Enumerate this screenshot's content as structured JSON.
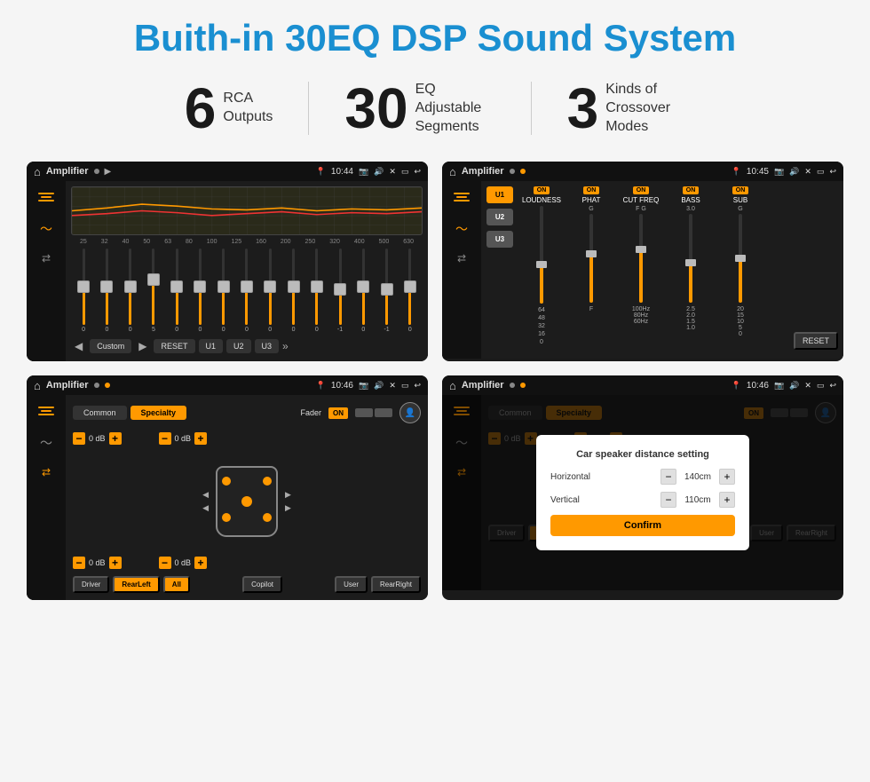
{
  "header": {
    "title": "Buith-in 30EQ DSP Sound System"
  },
  "stats": [
    {
      "number": "6",
      "text": "RCA\nOutputs"
    },
    {
      "number": "30",
      "text": "EQ Adjustable\nSegments"
    },
    {
      "number": "3",
      "text": "Kinds of\nCrossover Modes"
    }
  ],
  "screens": {
    "eq": {
      "topbar": {
        "title": "Amplifier",
        "time": "10:44"
      },
      "eq_bands": [
        "25",
        "32",
        "40",
        "50",
        "63",
        "80",
        "100",
        "125",
        "160",
        "200",
        "250",
        "320",
        "400",
        "500",
        "630"
      ],
      "eq_values": [
        "0",
        "0",
        "0",
        "5",
        "0",
        "0",
        "0",
        "0",
        "0",
        "0",
        "0",
        "-1",
        "0",
        "-1",
        "0"
      ],
      "eq_buttons": [
        "Custom",
        "RESET",
        "U1",
        "U2",
        "U3"
      ]
    },
    "crossover": {
      "topbar": {
        "title": "Amplifier",
        "time": "10:45"
      },
      "presets": [
        "U1",
        "U2",
        "U3"
      ],
      "channels": [
        {
          "name": "LOUDNESS",
          "on": true
        },
        {
          "name": "PHAT",
          "on": true
        },
        {
          "name": "CUT FREQ",
          "on": true
        },
        {
          "name": "BASS",
          "on": true
        },
        {
          "name": "SUB",
          "on": true
        }
      ],
      "reset": "RESET"
    },
    "fader": {
      "topbar": {
        "title": "Amplifier",
        "time": "10:46"
      },
      "tabs": [
        "Common",
        "Specialty"
      ],
      "fader_label": "Fader",
      "fader_on": "ON",
      "buttons": [
        "Driver",
        "RearLeft",
        "All",
        "Copilot",
        "RearRight",
        "User"
      ]
    },
    "distance": {
      "topbar": {
        "title": "Amplifier",
        "time": "10:46"
      },
      "tabs": [
        "Common",
        "Specialty"
      ],
      "dialog": {
        "title": "Car speaker distance setting",
        "horizontal_label": "Horizontal",
        "horizontal_value": "140cm",
        "vertical_label": "Vertical",
        "vertical_value": "110cm",
        "confirm": "Confirm"
      }
    }
  }
}
